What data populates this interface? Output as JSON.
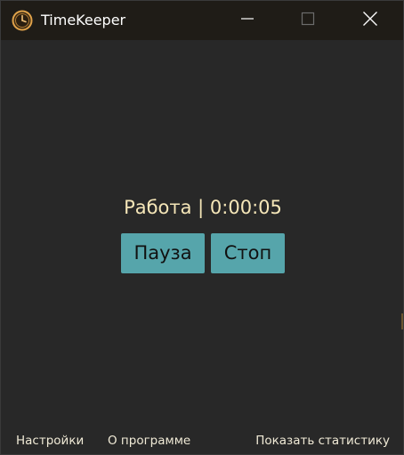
{
  "window": {
    "title": "TimeKeeper",
    "icon": "clock-icon",
    "controls": [
      "minimize-icon",
      "maximize-icon",
      "close-icon"
    ]
  },
  "timer": {
    "status": "Работа | 0:00:05"
  },
  "buttons": {
    "pause_label": "Пауза",
    "stop_label": "Стоп"
  },
  "footer": {
    "settings_label": "Настройки",
    "about_label": "О программе",
    "stats_label": "Показать статистику"
  },
  "colors": {
    "background": "#282828",
    "titlebar": "#1f1c17",
    "accent_button": "#56a5ab",
    "status_text": "#f5e6b8",
    "link_text": "#f0ead6"
  }
}
